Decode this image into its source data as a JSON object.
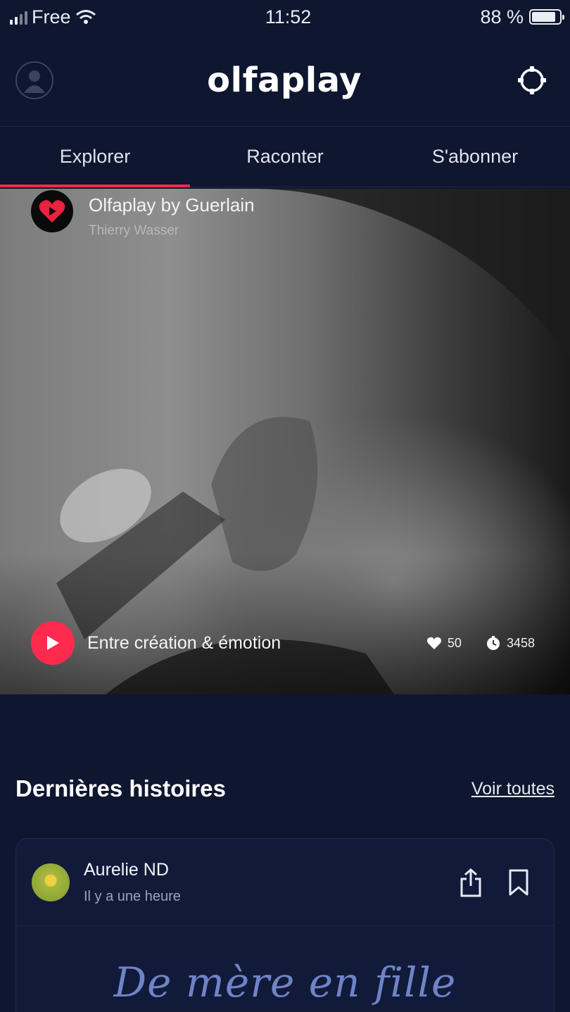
{
  "status_bar": {
    "carrier": "Free",
    "time": "11:52",
    "battery": "88 %",
    "battery_level": 0.88
  },
  "header": {
    "logo": "olfaplay",
    "avatar_icon": "user-icon",
    "settings_icon": "settings-icon"
  },
  "tabs": [
    {
      "label": "Explorer",
      "active": true
    },
    {
      "label": "Raconter",
      "active": false
    },
    {
      "label": "S'abonner",
      "active": false
    }
  ],
  "hero": {
    "channel_title": "Olfaplay by Guerlain",
    "channel_subtitle": "Thierry Wasser",
    "episode_title": "Entre création & émotion",
    "likes": "50",
    "listens": "3458"
  },
  "section": {
    "title": "Dernières histoires",
    "see_all": "Voir toutes"
  },
  "story": {
    "author": "Aurelie ND",
    "time_ago": "Il y a une heure",
    "title": "De mère en fille"
  },
  "colors": {
    "background": "#0e1630",
    "accent": "#ff2b4e",
    "story_title": "#6f83c7"
  }
}
